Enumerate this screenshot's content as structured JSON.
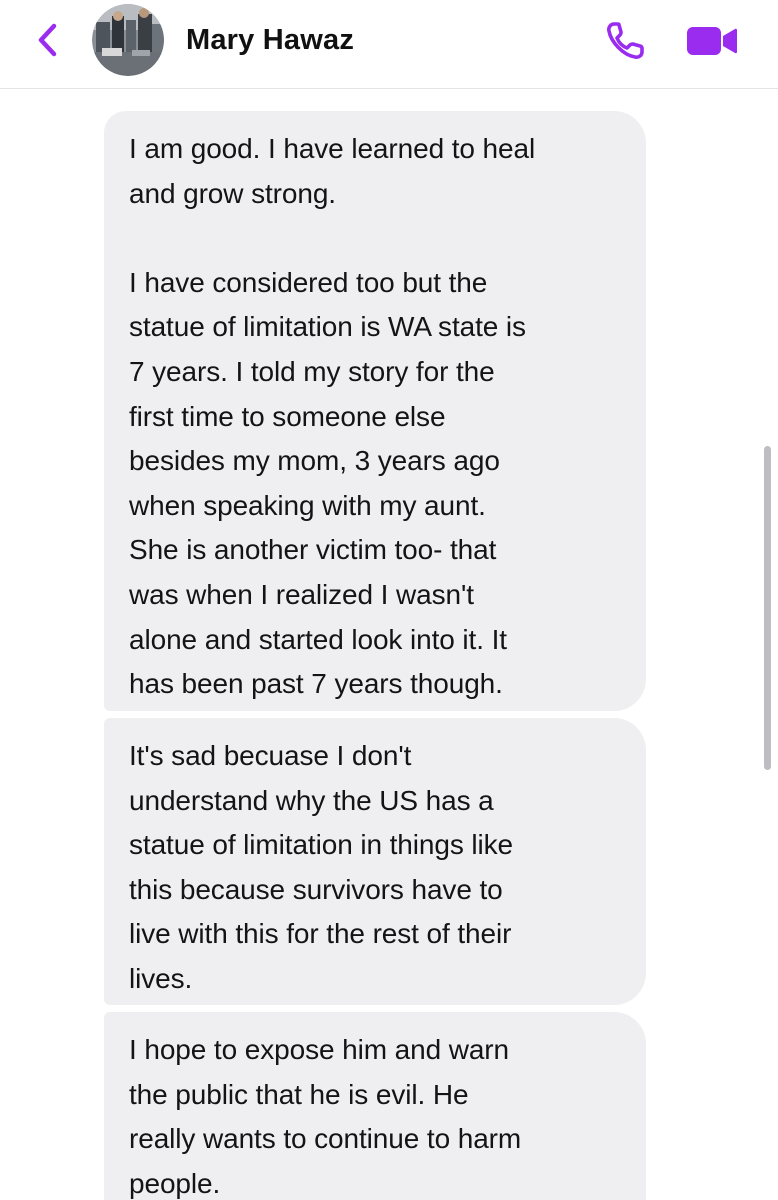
{
  "header": {
    "contact_name": "Mary Hawaz",
    "accent_color": "#9a2cf0",
    "icons": [
      "chevron-left-icon",
      "avatar",
      "phone-icon",
      "video-camera-icon"
    ]
  },
  "messages": [
    {
      "text": "I am good. I have learned to heal\nand grow strong.\n\nI have considered too but the\nstatue of limitation is WA state is\n7 years. I told my story for the\nfirst time to someone else\nbesides my mom, 3 years ago\nwhen speaking with my aunt.\nShe is another victim too- that\nwas when I realized I wasn't\nalone and started look into it. It\nhas been past 7 years though."
    },
    {
      "text": "It's sad becuase I don't\nunderstand why the US has a\nstatue of limitation in things like\nthis because survivors have to\nlive with this for the rest of their\nlives."
    },
    {
      "text": "I hope to expose him and warn\nthe public that he is evil. He\nreally wants to continue to harm\npeople."
    }
  ]
}
